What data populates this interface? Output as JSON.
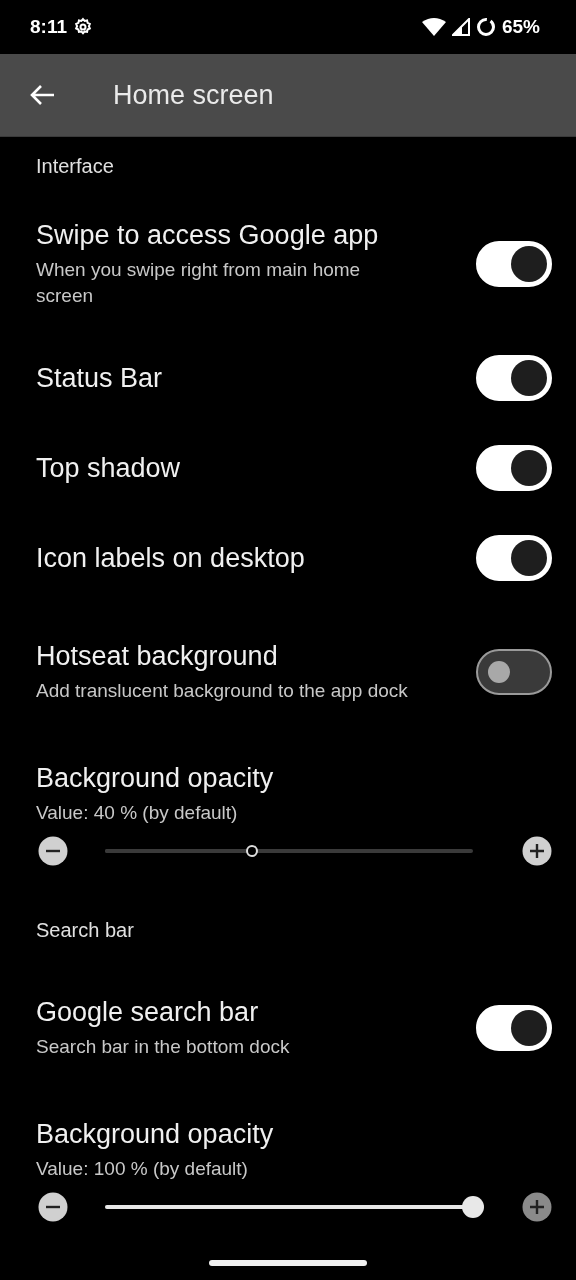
{
  "status_bar": {
    "time": "8:11",
    "battery": "65%"
  },
  "app_bar": {
    "title": "Home screen"
  },
  "items": [
    {
      "kind": "header",
      "title": "Interface"
    },
    {
      "kind": "switch",
      "title": "Swipe to access Google app",
      "subtitle": "When you swipe right from main home screen",
      "on": true
    },
    {
      "kind": "switch",
      "title": "Status Bar",
      "on": true
    },
    {
      "kind": "switch",
      "title": "Top shadow",
      "on": true
    },
    {
      "kind": "switch",
      "title": "Icon labels on desktop",
      "on": true
    },
    {
      "kind": "switch",
      "title": "Hotseat background",
      "subtitle": "Add translucent background to the app dock",
      "on": false
    },
    {
      "kind": "slider",
      "title": "Background opacity",
      "subtitle": "Value: 40 % (by default)",
      "level": 0.4,
      "disabled": true
    },
    {
      "kind": "header",
      "title": "Search bar"
    },
    {
      "kind": "switch",
      "title": "Google search bar",
      "subtitle": "Search bar in the bottom dock",
      "on": true
    },
    {
      "kind": "slider",
      "title": "Background opacity",
      "subtitle": "Value: 100 % (by default)",
      "level": 1,
      "disabled": false
    }
  ]
}
